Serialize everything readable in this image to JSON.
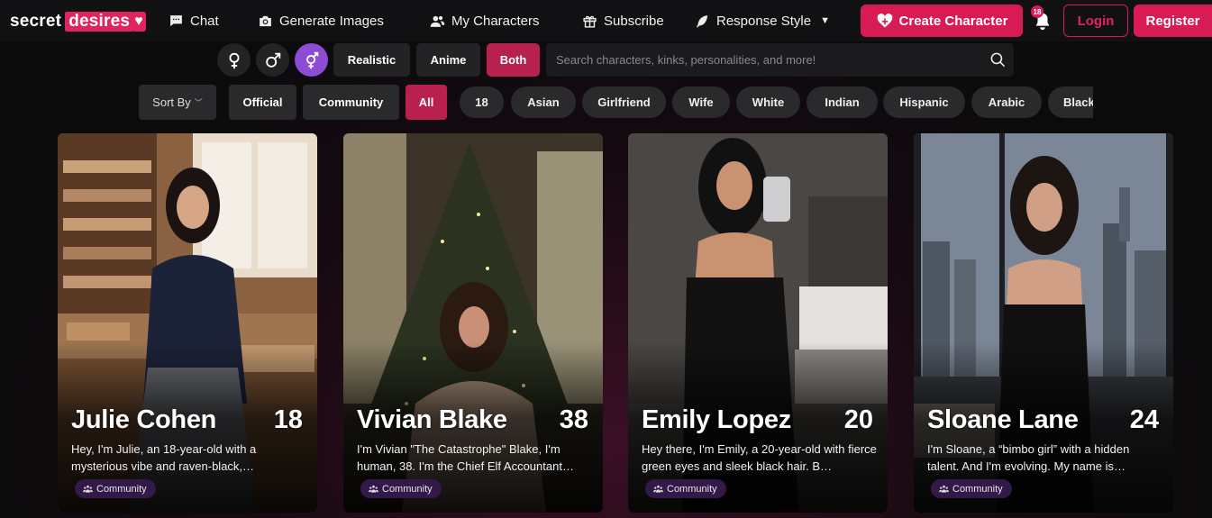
{
  "brand": {
    "word1": "secret",
    "word2": "desires",
    "heart": "♥"
  },
  "nav": {
    "chat": "Chat",
    "generate": "Generate Images",
    "characters": "My Characters",
    "subscribe": "Subscribe",
    "response_style": "Response Style",
    "create": "Create Character",
    "login": "Login",
    "register": "Register",
    "notification_badge": "18"
  },
  "filters": {
    "gender_icons": [
      "female-icon",
      "male-icon",
      "trans-icon"
    ],
    "styles": [
      "Realistic",
      "Anime",
      "Both"
    ],
    "active_style": "Both",
    "search_placeholder": "Search characters, kinks, personalities, and more!",
    "sort_label": "Sort By",
    "types": [
      "Official",
      "Community",
      "All"
    ],
    "active_type": "All",
    "tags": [
      "18",
      "Asian",
      "Girlfriend",
      "Wife",
      "White",
      "Indian",
      "Hispanic",
      "Arabic",
      "Black"
    ]
  },
  "cards": [
    {
      "name": "Julie Cohen",
      "age": "18",
      "desc": "Hey, I'm Julie, an 18-year-old with a mysterious vibe and raven-black,…",
      "badge": "Community"
    },
    {
      "name": "Vivian Blake",
      "age": "38",
      "desc": "I'm Vivian \"The Catastrophe\" Blake, I'm human, 38. I'm the Chief Elf Accountant…",
      "badge": "Community"
    },
    {
      "name": "Emily Lopez",
      "age": "20",
      "desc": "Hey there, I'm Emily, a 20-year-old with fierce green eyes and sleek black hair. B…",
      "badge": "Community"
    },
    {
      "name": "Sloane Lane",
      "age": "24",
      "desc": "I'm Sloane, a “bimbo girl” with a hidden talent. And I'm evolving. My name is…",
      "badge": "Community"
    }
  ],
  "colors": {
    "accent": "#d81b55",
    "purple": "#8e4bd6",
    "badge_bg": "#321948"
  }
}
